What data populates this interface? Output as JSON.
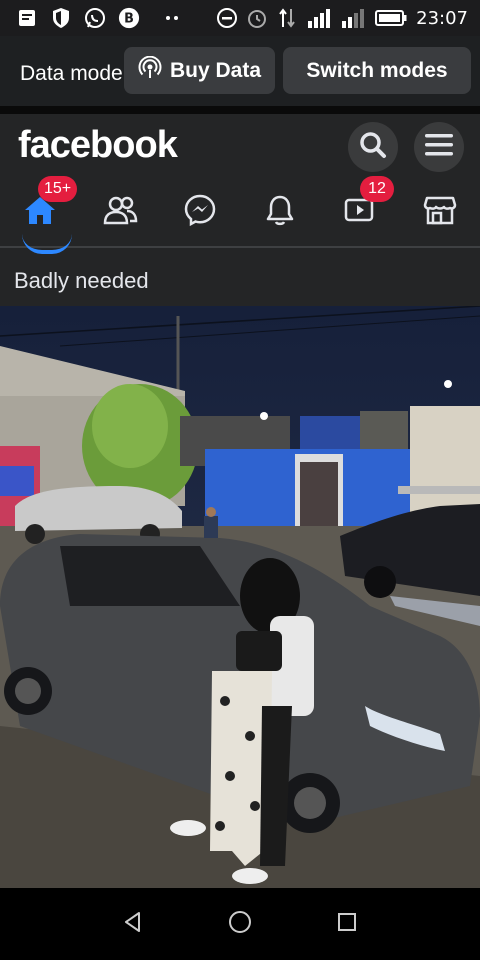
{
  "status_bar": {
    "time": "23:07",
    "icons": [
      "message-icon",
      "shield-icon",
      "whatsapp-icon",
      "b-app-icon",
      "dots-icon",
      "dnd-icon",
      "alarm-icon",
      "data-arrows-icon",
      "signal-icon",
      "signal-icon-2",
      "battery-icon"
    ]
  },
  "data_banner": {
    "label": "Data mode",
    "buy_label": "Buy Data",
    "switch_label": "Switch modes"
  },
  "header": {
    "logo": "facebook",
    "icons": [
      "search-icon",
      "menu-icon"
    ]
  },
  "nav": {
    "items": [
      {
        "name": "home",
        "badge": "15+",
        "active": true
      },
      {
        "name": "friends",
        "badge": ""
      },
      {
        "name": "messenger",
        "badge": ""
      },
      {
        "name": "notifications",
        "badge": ""
      },
      {
        "name": "watch",
        "badge": "12"
      },
      {
        "name": "marketplace",
        "badge": ""
      }
    ]
  },
  "post": {
    "caption": "Badly needed"
  },
  "colors": {
    "fb_blue": "#2d88ff",
    "badge_red": "#e41e3f",
    "surface": "#242526"
  }
}
